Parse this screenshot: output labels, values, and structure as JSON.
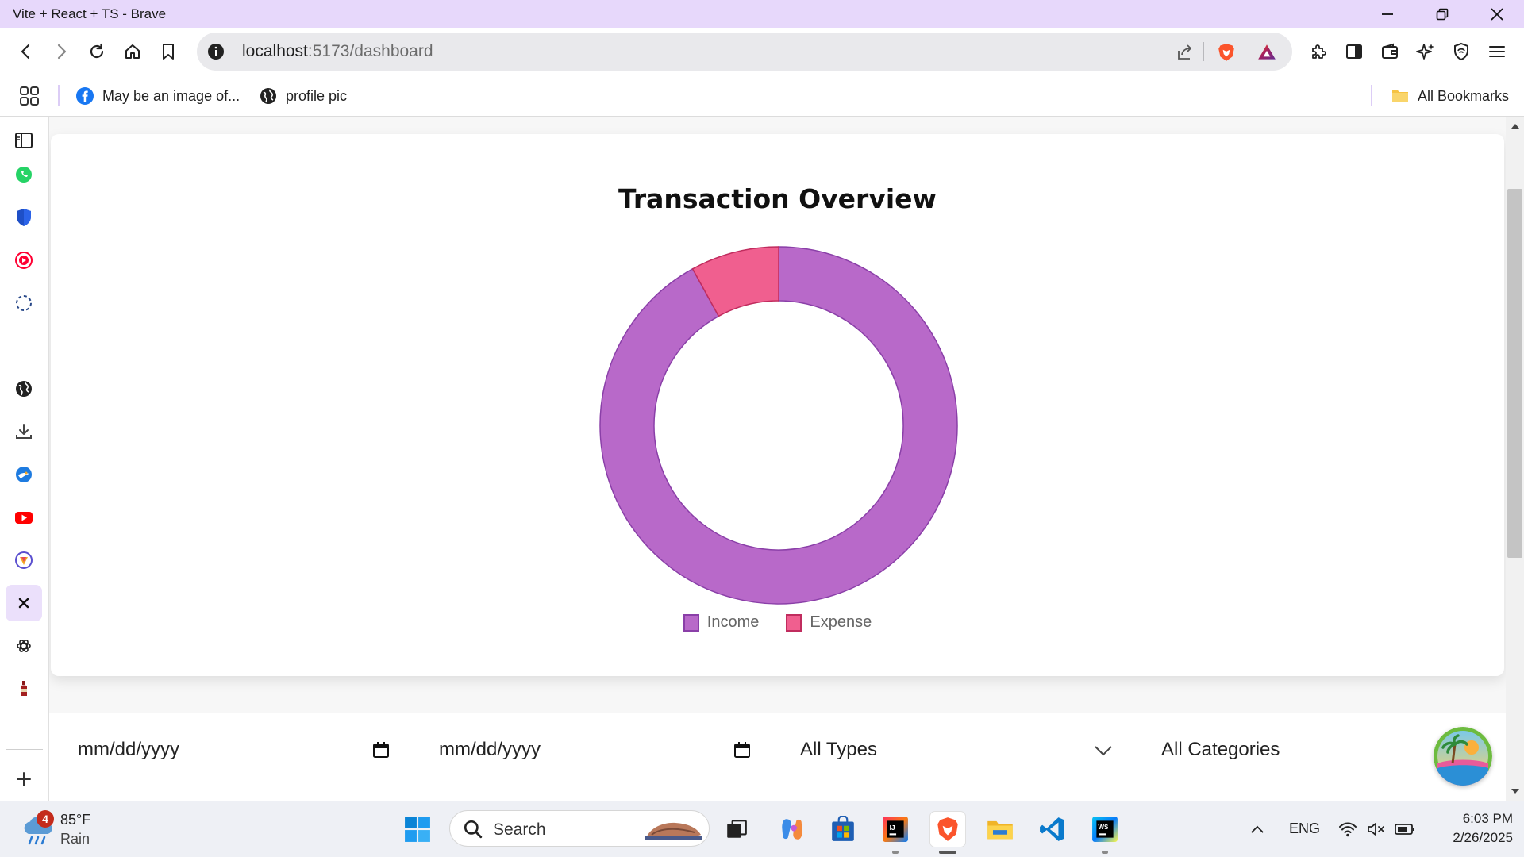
{
  "window": {
    "title": "Vite + React + TS - Brave"
  },
  "address_bar": {
    "host": "localhost",
    "path": ":5173/dashboard"
  },
  "bookmarks": {
    "items": [
      {
        "label": "May be an image of...",
        "icon": "facebook-icon"
      },
      {
        "label": "profile pic",
        "icon": "globe-icon"
      }
    ],
    "all_bookmarks": "All Bookmarks"
  },
  "sidebar": {
    "items": [
      "sidebar-panel-icon",
      "whatsapp-icon",
      "brave-vpn-icon",
      "youtube-icon",
      "loading-icon",
      "globe-icon",
      "download-icon",
      "bird-icon",
      "youtube-icon",
      "brave-rewards-icon",
      "x-icon",
      "chatgpt-icon",
      "bottle-icon"
    ],
    "add_label": "+"
  },
  "chart_data": {
    "type": "pie",
    "title": "Transaction Overview",
    "labels": [
      "Income",
      "Expense"
    ],
    "values": [
      92,
      8
    ],
    "colors": [
      "#b869c9",
      "#f05f8f"
    ],
    "borders": [
      "#8a3fa8",
      "#c02c5e"
    ],
    "donut": true,
    "legend_position": "bottom"
  },
  "filters": {
    "start_date_placeholder": "mm/dd/yyyy",
    "end_date_placeholder": "mm/dd/yyyy",
    "type_selected": "All Types",
    "category_selected": "All Categories"
  },
  "taskbar": {
    "weather": {
      "temp": "85°F",
      "condition": "Rain",
      "badge": "4"
    },
    "search_label": "Search",
    "tray": {
      "language": "ENG"
    },
    "clock": {
      "time": "6:03 PM",
      "date": "2/26/2025"
    }
  }
}
